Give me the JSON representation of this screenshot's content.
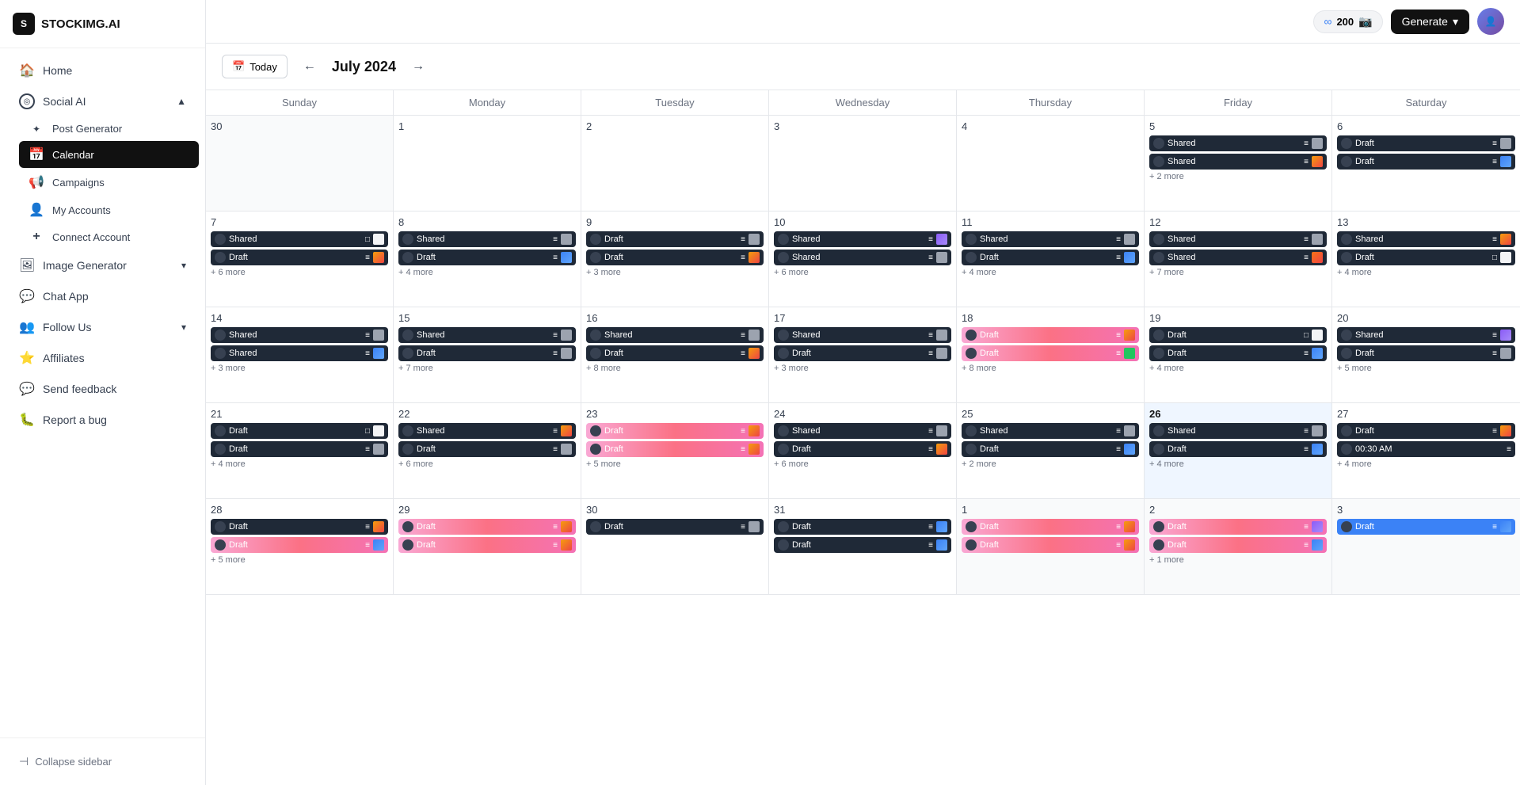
{
  "app": {
    "logo_text": "STOCKIMG.AI",
    "logo_short": "S"
  },
  "topbar": {
    "credits_inf": "∞",
    "credits_count": "200",
    "generate_label": "Generate",
    "generate_chevron": "▾"
  },
  "sidebar": {
    "nav_items": [
      {
        "id": "home",
        "label": "Home",
        "icon": "🏠",
        "active": false
      },
      {
        "id": "social-ai",
        "label": "Social AI",
        "icon": "◎",
        "active": true,
        "expanded": true
      },
      {
        "id": "post-generator",
        "label": "Post Generator",
        "icon": "",
        "sub": true,
        "active": false
      },
      {
        "id": "calendar",
        "label": "Calendar",
        "icon": "📅",
        "sub": true,
        "active": true
      },
      {
        "id": "campaigns",
        "label": "Campaigns",
        "icon": "📢",
        "sub": true,
        "active": false
      },
      {
        "id": "my-accounts",
        "label": "My Accounts",
        "icon": "👤",
        "sub": true,
        "active": false
      },
      {
        "id": "connect-account",
        "label": "Connect Account",
        "icon": "+",
        "sub": true,
        "active": false
      },
      {
        "id": "image-generator",
        "label": "Image Generator",
        "icon": "🖼",
        "active": false,
        "hasChevron": true
      },
      {
        "id": "chat-app",
        "label": "Chat App",
        "icon": "💬",
        "active": false
      },
      {
        "id": "follow-us",
        "label": "Follow Us",
        "icon": "👥",
        "active": false,
        "hasChevron": true
      },
      {
        "id": "affiliates",
        "label": "Affiliates",
        "icon": "⭐",
        "active": false
      },
      {
        "id": "send-feedback",
        "label": "Send feedback",
        "icon": "💬",
        "active": false
      },
      {
        "id": "report-bug",
        "label": "Report a bug",
        "icon": "🐛",
        "active": false
      }
    ],
    "collapse_label": "Collapse sidebar"
  },
  "calendar": {
    "today_label": "Today",
    "month_year": "July 2024",
    "weekdays": [
      "Sunday",
      "Monday",
      "Tuesday",
      "Wednesday",
      "Thursday",
      "Friday",
      "Saturday"
    ],
    "weeks": [
      {
        "days": [
          {
            "num": "30",
            "other": true,
            "events": [],
            "more": null
          },
          {
            "num": "1",
            "events": [],
            "more": null
          },
          {
            "num": "2",
            "events": [],
            "more": null
          },
          {
            "num": "3",
            "events": [],
            "more": null
          },
          {
            "num": "4",
            "events": [],
            "more": null
          },
          {
            "num": "5",
            "events": [
              {
                "type": "shared",
                "label": "Shared",
                "icon": "≡",
                "dotClass": "dot-dark",
                "thumbClass": "thumb-gray"
              },
              {
                "type": "shared",
                "label": "Shared",
                "icon": "≡",
                "dotClass": "dot-dark",
                "thumbClass": "thumb-colorful"
              }
            ],
            "more": "+ 2 more"
          },
          {
            "num": "6",
            "events": [
              {
                "type": "draft",
                "label": "Draft",
                "icon": "≡",
                "dotClass": "dot-dark",
                "thumbClass": "thumb-gray"
              },
              {
                "type": "draft",
                "label": "Draft",
                "icon": "≡",
                "dotClass": "dot-dark",
                "thumbClass": "thumb-blue"
              }
            ],
            "more": null
          }
        ]
      },
      {
        "days": [
          {
            "num": "7",
            "events": [
              {
                "type": "shared",
                "label": "Shared",
                "icon": "□",
                "dotClass": "dot-dark",
                "thumbClass": "thumb-white"
              },
              {
                "type": "draft",
                "label": "Draft",
                "icon": "≡",
                "dotClass": "dot-dark",
                "thumbClass": "thumb-colorful"
              }
            ],
            "more": "+ 6 more"
          },
          {
            "num": "8",
            "events": [
              {
                "type": "shared",
                "label": "Shared",
                "icon": "≡",
                "dotClass": "dot-dark",
                "thumbClass": "thumb-gray"
              },
              {
                "type": "draft",
                "label": "Draft",
                "icon": "≡",
                "dotClass": "dot-dark",
                "thumbClass": "thumb-blue"
              }
            ],
            "more": "+ 4 more"
          },
          {
            "num": "9",
            "events": [
              {
                "type": "draft",
                "label": "Draft",
                "icon": "≡",
                "dotClass": "dot-dark",
                "thumbClass": "thumb-gray"
              },
              {
                "type": "draft",
                "label": "Draft",
                "icon": "≡",
                "dotClass": "dot-dark",
                "thumbClass": "thumb-colorful"
              }
            ],
            "more": "+ 3 more"
          },
          {
            "num": "10",
            "events": [
              {
                "type": "shared",
                "label": "Shared",
                "icon": "≡",
                "dotClass": "dot-purple",
                "thumbClass": "thumb-purple"
              },
              {
                "type": "shared",
                "label": "Shared",
                "icon": "≡",
                "dotClass": "dot-dark",
                "thumbClass": "thumb-gray"
              }
            ],
            "more": "+ 6 more"
          },
          {
            "num": "11",
            "events": [
              {
                "type": "shared",
                "label": "Shared",
                "icon": "≡",
                "dotClass": "dot-dark",
                "thumbClass": "thumb-gray"
              },
              {
                "type": "draft",
                "label": "Draft",
                "icon": "≡",
                "dotClass": "dot-dark",
                "thumbClass": "thumb-blue"
              }
            ],
            "more": "+ 4 more"
          },
          {
            "num": "12",
            "events": [
              {
                "type": "shared",
                "label": "Shared",
                "icon": "≡",
                "dotClass": "dot-dark",
                "thumbClass": "thumb-gray"
              },
              {
                "type": "shared",
                "label": "Shared",
                "icon": "≡",
                "dotClass": "dot-dark",
                "thumbClass": "thumb-orange"
              }
            ],
            "more": "+ 7 more"
          },
          {
            "num": "13",
            "events": [
              {
                "type": "shared",
                "label": "Shared",
                "icon": "≡",
                "dotClass": "dot-dark",
                "thumbClass": "thumb-colorful"
              },
              {
                "type": "draft",
                "label": "Draft",
                "icon": "□",
                "dotClass": "dot-dark",
                "thumbClass": "thumb-white"
              }
            ],
            "more": "+ 4 more"
          }
        ]
      },
      {
        "days": [
          {
            "num": "14",
            "events": [
              {
                "type": "shared",
                "label": "Shared",
                "icon": "≡",
                "dotClass": "dot-dark",
                "thumbClass": "thumb-gray"
              },
              {
                "type": "shared",
                "label": "Shared",
                "icon": "≡",
                "dotClass": "dot-dark",
                "thumbClass": "thumb-blue"
              }
            ],
            "more": "+ 3 more"
          },
          {
            "num": "15",
            "events": [
              {
                "type": "shared",
                "label": "Shared",
                "icon": "≡",
                "dotClass": "dot-dark",
                "thumbClass": "thumb-gray"
              },
              {
                "type": "draft",
                "label": "Draft",
                "icon": "≡",
                "dotClass": "dot-dark",
                "thumbClass": "thumb-gray"
              }
            ],
            "more": "+ 7 more"
          },
          {
            "num": "16",
            "events": [
              {
                "type": "shared",
                "label": "Shared",
                "icon": "≡",
                "dotClass": "dot-dark",
                "thumbClass": "thumb-gray"
              },
              {
                "type": "draft",
                "label": "Draft",
                "icon": "≡",
                "dotClass": "dot-dark",
                "thumbClass": "thumb-colorful"
              }
            ],
            "more": "+ 8 more"
          },
          {
            "num": "17",
            "events": [
              {
                "type": "shared",
                "label": "Shared",
                "icon": "≡",
                "dotClass": "dot-dark",
                "thumbClass": "thumb-gray"
              },
              {
                "type": "draft",
                "label": "Draft",
                "icon": "≡",
                "dotClass": "dot-dark",
                "thumbClass": "thumb-gray"
              }
            ],
            "more": "+ 3 more"
          },
          {
            "num": "18",
            "events": [
              {
                "type": "draft-pink",
                "label": "Draft",
                "icon": "≡",
                "dotClass": "dot-pink",
                "thumbClass": "thumb-colorful"
              },
              {
                "type": "draft-pink",
                "label": "Draft",
                "icon": "≡",
                "dotClass": "dot-pink",
                "thumbClass": "thumb-green"
              }
            ],
            "more": "+ 8 more"
          },
          {
            "num": "19",
            "events": [
              {
                "type": "draft",
                "label": "Draft",
                "icon": "□",
                "dotClass": "dot-dark",
                "thumbClass": "thumb-white"
              },
              {
                "type": "draft",
                "label": "Draft",
                "icon": "≡",
                "dotClass": "dot-dark",
                "thumbClass": "thumb-blue"
              }
            ],
            "more": "+ 4 more"
          },
          {
            "num": "20",
            "events": [
              {
                "type": "shared",
                "label": "Shared",
                "icon": "≡",
                "dotClass": "dot-purple",
                "thumbClass": "thumb-purple"
              },
              {
                "type": "draft",
                "label": "Draft",
                "icon": "≡",
                "dotClass": "dot-dark",
                "thumbClass": "thumb-gray"
              }
            ],
            "more": "+ 5 more"
          }
        ]
      },
      {
        "days": [
          {
            "num": "21",
            "events": [
              {
                "type": "draft",
                "label": "Draft",
                "icon": "□",
                "dotClass": "dot-dark",
                "thumbClass": "thumb-white"
              },
              {
                "type": "draft",
                "label": "Draft",
                "icon": "≡",
                "dotClass": "dot-dark",
                "thumbClass": "thumb-gray"
              }
            ],
            "more": "+ 4 more"
          },
          {
            "num": "22",
            "events": [
              {
                "type": "shared",
                "label": "Shared",
                "icon": "≡",
                "dotClass": "dot-dark",
                "thumbClass": "thumb-colorful"
              },
              {
                "type": "draft",
                "label": "Draft",
                "icon": "≡",
                "dotClass": "dot-dark",
                "thumbClass": "thumb-gray"
              }
            ],
            "more": "+ 6 more"
          },
          {
            "num": "23",
            "events": [
              {
                "type": "draft-pink",
                "label": "Draft",
                "icon": "≡",
                "dotClass": "dot-pink",
                "thumbClass": "thumb-colorful"
              },
              {
                "type": "draft-pink",
                "label": "Draft",
                "icon": "≡",
                "dotClass": "dot-pink",
                "thumbClass": "thumb-colorful"
              }
            ],
            "more": "+ 5 more"
          },
          {
            "num": "24",
            "events": [
              {
                "type": "shared",
                "label": "Shared",
                "icon": "≡",
                "dotClass": "dot-dark",
                "thumbClass": "thumb-gray"
              },
              {
                "type": "draft",
                "label": "Draft",
                "icon": "≡",
                "dotClass": "dot-dark",
                "thumbClass": "thumb-colorful"
              }
            ],
            "more": "+ 6 more"
          },
          {
            "num": "25",
            "events": [
              {
                "type": "shared",
                "label": "Shared",
                "icon": "≡",
                "dotClass": "dot-dark",
                "thumbClass": "thumb-gray"
              },
              {
                "type": "draft",
                "label": "Draft",
                "icon": "≡",
                "dotClass": "dot-dark",
                "thumbClass": "thumb-blue"
              }
            ],
            "more": "+ 2 more"
          },
          {
            "num": "26",
            "highlight": true,
            "events": [
              {
                "type": "shared",
                "label": "Shared",
                "icon": "≡",
                "dotClass": "dot-dark",
                "thumbClass": "thumb-gray"
              },
              {
                "type": "draft",
                "label": "Draft",
                "icon": "≡",
                "dotClass": "dot-dark",
                "thumbClass": "thumb-blue"
              }
            ],
            "more": "+ 4 more"
          },
          {
            "num": "27",
            "events": [
              {
                "type": "draft",
                "label": "Draft",
                "icon": "≡",
                "dotClass": "dot-dark",
                "thumbClass": "thumb-colorful"
              },
              {
                "type": "draft",
                "label": "00:30 AM",
                "icon": "≡",
                "dotClass": "dot-dark",
                "thumbClass": "thumb-gray"
              }
            ],
            "more": "+ 4 more"
          }
        ]
      },
      {
        "days": [
          {
            "num": "28",
            "events": [
              {
                "type": "draft",
                "label": "Draft",
                "icon": "≡",
                "dotClass": "dot-dark",
                "thumbClass": "thumb-colorful"
              },
              {
                "type": "draft-pink",
                "label": "Draft",
                "icon": "≡",
                "dotClass": "dot-pink",
                "thumbClass": "thumb-blue"
              }
            ],
            "more": "+ 5 more"
          },
          {
            "num": "29",
            "events": [
              {
                "type": "draft-pink",
                "label": "Draft",
                "icon": "≡",
                "dotClass": "dot-pink",
                "thumbClass": "thumb-colorful"
              },
              {
                "type": "draft-pink",
                "label": "Draft",
                "icon": "≡",
                "dotClass": "dot-pink",
                "thumbClass": "thumb-colorful"
              }
            ],
            "more": null
          },
          {
            "num": "30",
            "events": [
              {
                "type": "draft",
                "label": "Draft",
                "icon": "≡",
                "dotClass": "dot-dark",
                "thumbClass": "thumb-gray"
              }
            ],
            "more": null
          },
          {
            "num": "31",
            "events": [
              {
                "type": "draft",
                "label": "Draft",
                "icon": "≡",
                "dotClass": "dot-dark",
                "thumbClass": "thumb-blue"
              },
              {
                "type": "draft",
                "label": "Draft",
                "icon": "≡",
                "dotClass": "dot-dark",
                "thumbClass": "thumb-blue"
              }
            ],
            "more": null
          },
          {
            "num": "1",
            "other": true,
            "events": [
              {
                "type": "draft-pink",
                "label": "Draft",
                "icon": "≡",
                "dotClass": "dot-pink",
                "thumbClass": "thumb-colorful"
              },
              {
                "type": "draft-pink",
                "label": "Draft",
                "icon": "≡",
                "dotClass": "dot-pink",
                "thumbClass": "thumb-colorful"
              }
            ],
            "more": null
          },
          {
            "num": "2",
            "other": true,
            "events": [
              {
                "type": "draft-pink",
                "label": "Draft",
                "icon": "≡",
                "dotClass": "dot-pink",
                "thumbClass": "thumb-purple"
              },
              {
                "type": "draft-pink",
                "label": "Draft",
                "icon": "≡",
                "dotClass": "dot-pink",
                "thumbClass": "thumb-blue"
              }
            ],
            "more": "+ 1 more"
          },
          {
            "num": "3",
            "other": true,
            "events": [
              {
                "type": "draft-blue",
                "label": "Draft",
                "icon": "≡",
                "dotClass": "dot-blue",
                "thumbClass": "thumb-blue"
              }
            ],
            "more": null
          }
        ]
      }
    ]
  }
}
